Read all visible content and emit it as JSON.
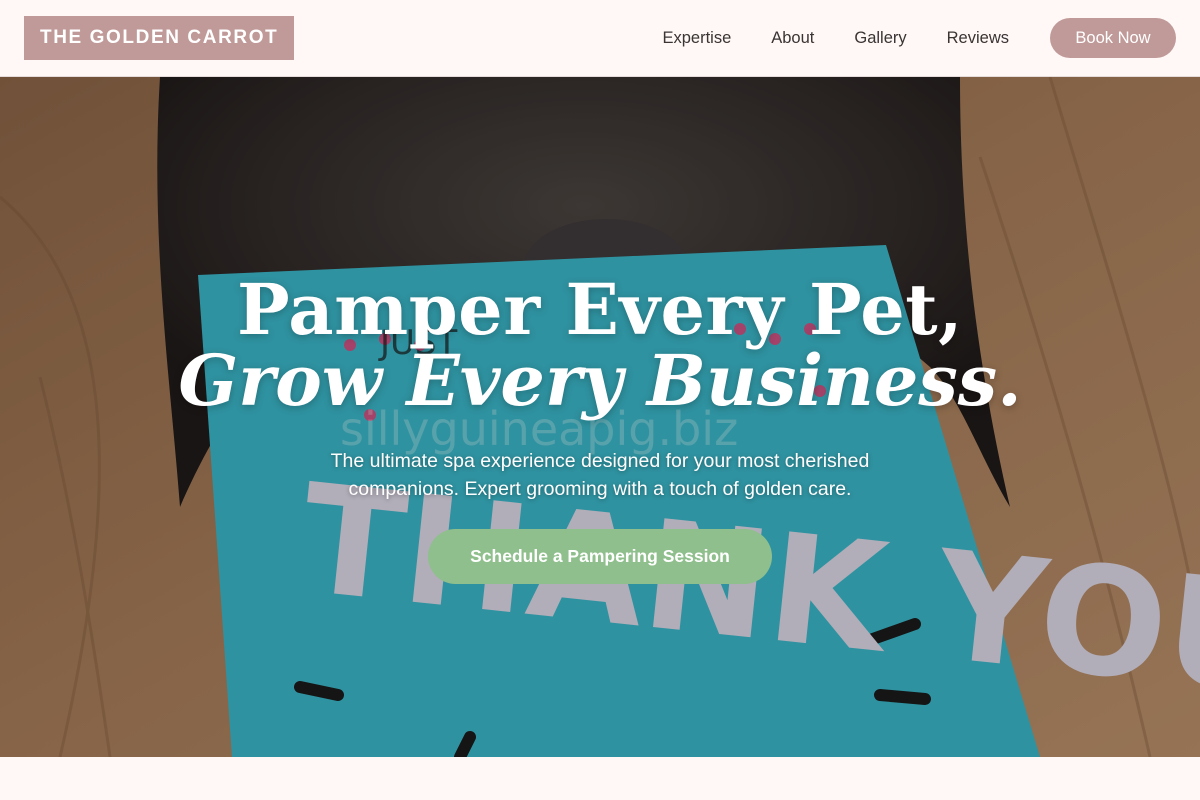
{
  "header": {
    "logo": "THE GOLDEN CARROT",
    "nav": [
      "Expertise",
      "About",
      "Gallery",
      "Reviews"
    ],
    "cta": "Book Now"
  },
  "hero": {
    "headline_line1": "Pamper Every Pet,",
    "headline_line2": "Grow Every Business.",
    "subtext": "The ultimate spa experience designed for your most cherished companions. Expert grooming with a touch of golden care.",
    "cta": "Schedule a Pampering Session",
    "background": {
      "card_text_large": "THANK YOU!",
      "card_text_small": "JUST",
      "watermark": "sillyguineapig.biz"
    }
  },
  "colors": {
    "brand": "#c09a98",
    "cta_green": "#8fbf8c",
    "page_bg": "#fff8f7",
    "card_teal": "#3ab3c4"
  }
}
